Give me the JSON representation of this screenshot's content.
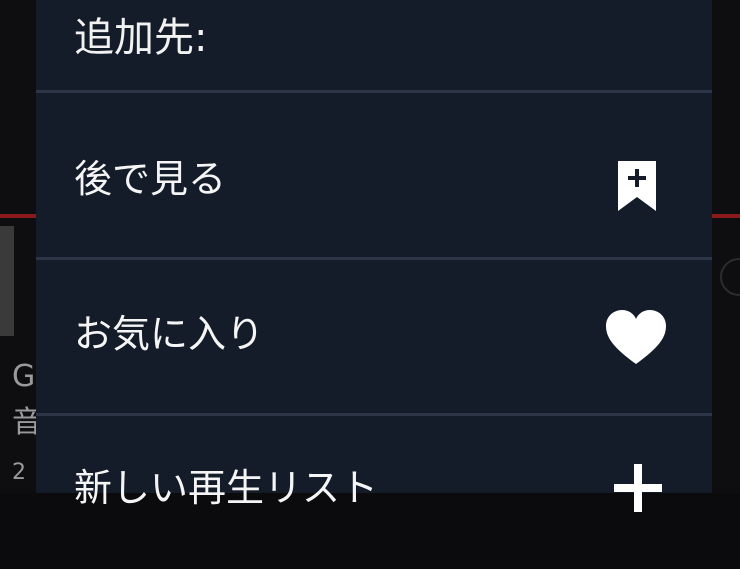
{
  "background": {
    "left_text_lines": [
      "G",
      "音",
      "2"
    ]
  },
  "menu": {
    "title": "追加先:",
    "items": [
      {
        "label": "後で見る",
        "icon": "bookmark-plus-icon"
      },
      {
        "label": "お気に入り",
        "icon": "heart-icon"
      },
      {
        "label": "新しい再生リスト",
        "icon": "plus-icon"
      }
    ]
  },
  "colors": {
    "menu_background": "#141b29",
    "divider": "#2b3547",
    "text": "#f5f5f5",
    "accent_red": "#8a1a1a"
  }
}
